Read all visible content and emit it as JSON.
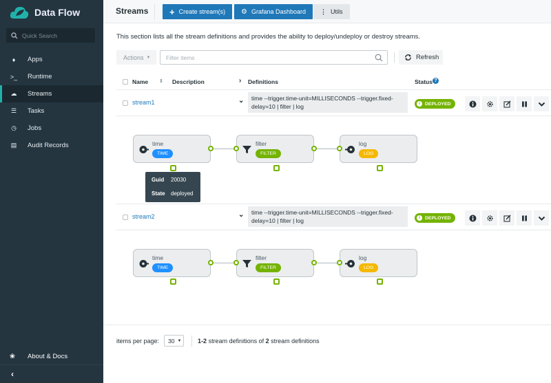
{
  "app": {
    "title": "Data Flow",
    "search_placeholder": "Quick Search"
  },
  "sidebar": {
    "items": [
      {
        "label": "Apps",
        "icon": "tags-icon"
      },
      {
        "label": "Runtime",
        "icon": "terminal-icon"
      },
      {
        "label": "Streams",
        "icon": "cloud-icon",
        "active": true
      },
      {
        "label": "Tasks",
        "icon": "tasks-icon"
      },
      {
        "label": "Jobs",
        "icon": "clock-icon"
      },
      {
        "label": "Audit Records",
        "icon": "archive-icon"
      }
    ],
    "about": "About & Docs"
  },
  "header": {
    "title": "Streams",
    "create": "Create stream(s)",
    "grafana": "Grafana Dashboard",
    "utils": "Utils"
  },
  "description": "This section lists all the stream definitions and provides the ability to deploy/undeploy or destroy streams.",
  "toolbar": {
    "actions": "Actions",
    "filter_placeholder": "Filter items",
    "refresh": "Refresh"
  },
  "table": {
    "headers": {
      "name": "Name",
      "description": "Description",
      "definitions": "Definitions",
      "status": "Status"
    },
    "rows": [
      {
        "name": "stream1",
        "definition": "time --trigger.time-unit=MILLISECONDS --trigger.fixed-delay=10 | filter | log",
        "status": "DEPLOYED",
        "nodes": [
          {
            "name": "time",
            "tag": "TIME"
          },
          {
            "name": "filter",
            "tag": "FILTER"
          },
          {
            "name": "log",
            "tag": "LOG"
          }
        ]
      },
      {
        "name": "stream2",
        "definition": "time --trigger.time-unit=MILLISECONDS --trigger.fixed-delay=10 | filter | log",
        "status": "DEPLOYED",
        "nodes": [
          {
            "name": "time",
            "tag": "TIME"
          },
          {
            "name": "filter",
            "tag": "FILTER"
          },
          {
            "name": "log",
            "tag": "LOG"
          }
        ]
      }
    ]
  },
  "tooltip": {
    "guid_label": "Guid",
    "guid": "20030",
    "state_label": "State",
    "state": "deployed"
  },
  "pager": {
    "label": "items per page:",
    "size": "30",
    "range": "1-2",
    "mid": " stream definitions of ",
    "total": "2",
    "tail": " stream definitions"
  },
  "colors": {
    "time": "#1e90ff",
    "filter": "#74b300",
    "log": "#f5b800",
    "deployed": "#74b300",
    "primary": "#1f78b8"
  }
}
